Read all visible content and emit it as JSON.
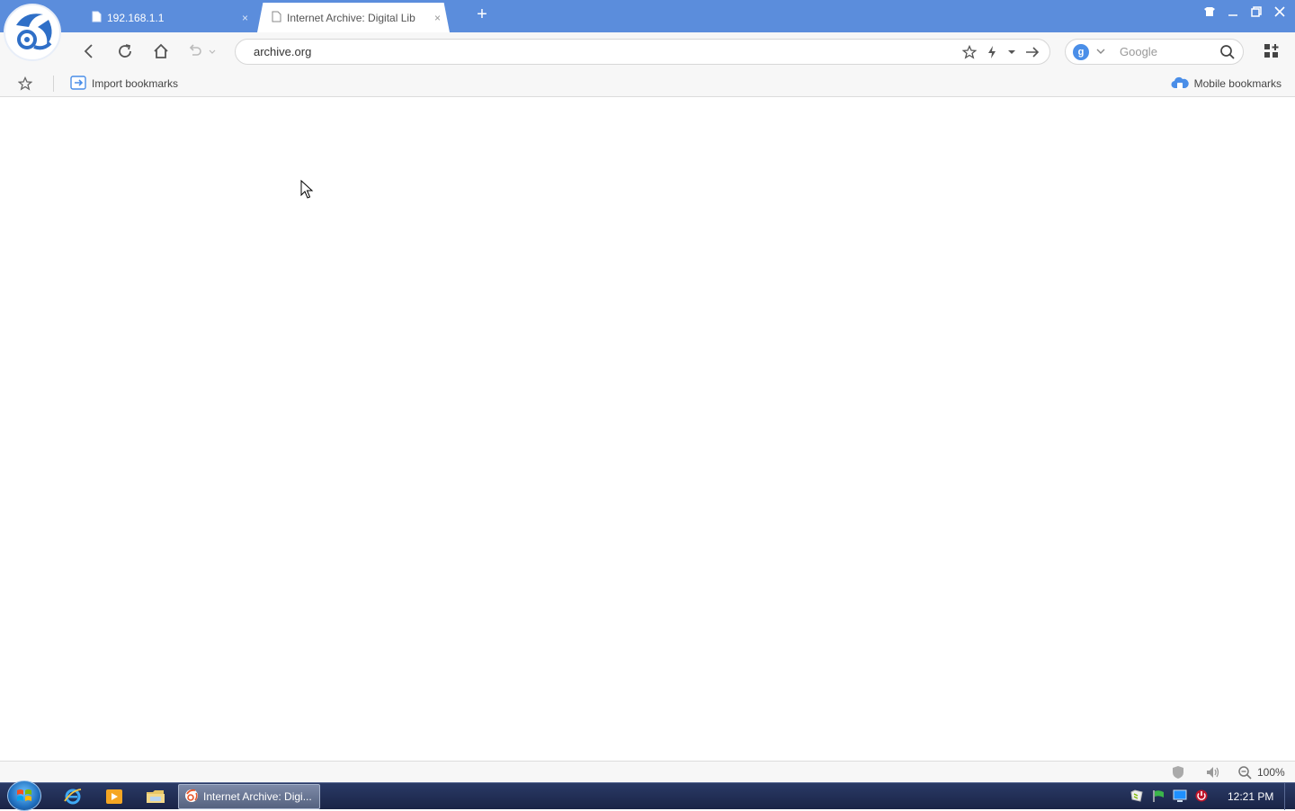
{
  "tabs": [
    {
      "title": "192.168.1.1",
      "close": "×",
      "active": false
    },
    {
      "title": "Internet Archive: Digital Lib",
      "close": "×",
      "active": true
    }
  ],
  "new_tab": "+",
  "address": {
    "url": "archive.org"
  },
  "search": {
    "placeholder": "Google",
    "engine_initial": "g"
  },
  "bookmarks": {
    "import_label": "Import bookmarks",
    "mobile_label": "Mobile bookmarks"
  },
  "status": {
    "zoom": "100%"
  },
  "taskbar": {
    "active_window": "Internet Archive: Digi...",
    "clock": "12:21 PM"
  },
  "colors": {
    "titlebar": "#5b8ddc",
    "taskbar": "#1a2446",
    "accent": "#4a8ee8"
  }
}
